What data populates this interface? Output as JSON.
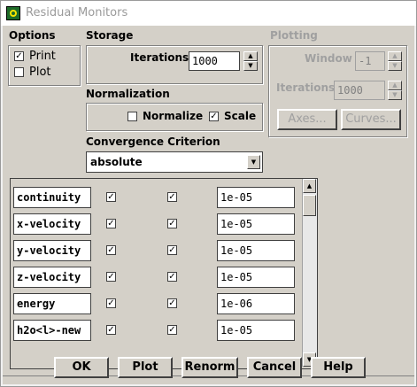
{
  "window": {
    "title": "Residual Monitors"
  },
  "options": {
    "label": "Options",
    "print_label": "Print",
    "print_checked": true,
    "plot_label": "Plot",
    "plot_checked": false
  },
  "storage": {
    "label": "Storage",
    "iterations_label": "Iterations",
    "iterations_value": "1000"
  },
  "plotting": {
    "label": "Plotting",
    "window_label": "Window",
    "window_value": "-1",
    "iterations_label": "Iterations",
    "iterations_value": "1000",
    "axes_button": "Axes...",
    "curves_button": "Curves..."
  },
  "normalization": {
    "label": "Normalization",
    "normalize_label": "Normalize",
    "normalize_checked": false,
    "scale_label": "Scale",
    "scale_checked": true
  },
  "convergence": {
    "label": "Convergence Criterion",
    "selected": "absolute"
  },
  "residuals": [
    {
      "name": "continuity",
      "monitor": true,
      "check_convergence": true,
      "criterion": "1e-05"
    },
    {
      "name": "x-velocity",
      "monitor": true,
      "check_convergence": true,
      "criterion": "1e-05"
    },
    {
      "name": "y-velocity",
      "monitor": true,
      "check_convergence": true,
      "criterion": "1e-05"
    },
    {
      "name": "z-velocity",
      "monitor": true,
      "check_convergence": true,
      "criterion": "1e-05"
    },
    {
      "name": "energy",
      "monitor": true,
      "check_convergence": true,
      "criterion": "1e-06"
    },
    {
      "name": "h2o<l>-new",
      "monitor": true,
      "check_convergence": true,
      "criterion": "1e-05"
    }
  ],
  "buttons": {
    "ok": "OK",
    "plot": "Plot",
    "renorm": "Renorm",
    "cancel": "Cancel",
    "help": "Help"
  },
  "check_glyph": "✓"
}
